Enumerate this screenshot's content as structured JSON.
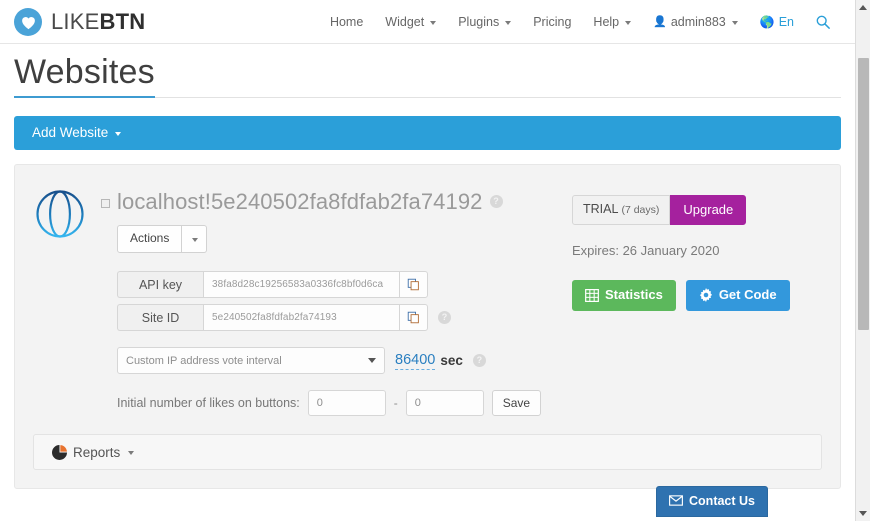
{
  "brand": {
    "part1": "LIKE",
    "part2": "BTN",
    "icon": "heart-icon"
  },
  "nav": {
    "items": [
      {
        "label": "Home",
        "caret": false
      },
      {
        "label": "Widget",
        "caret": true
      },
      {
        "label": "Plugins",
        "caret": true
      },
      {
        "label": "Pricing",
        "caret": false
      },
      {
        "label": "Help",
        "caret": true
      }
    ],
    "user": {
      "label": "admin883",
      "icon": "user-icon"
    },
    "language": {
      "label": "En",
      "icon": "globe-icon"
    },
    "search": {
      "icon": "search-icon"
    }
  },
  "page": {
    "title": "Websites",
    "add_website_label": "Add Website"
  },
  "site": {
    "icon": "globe-icon",
    "name": "localhost!5e240502fa8fdfab2fa74192",
    "help": "?",
    "actions_label": "Actions",
    "credentials": [
      {
        "label": "API key",
        "value": "38fa8d28c19256583a0336fc8bf0d6ca",
        "copy_icon": "copy-icon",
        "help": false
      },
      {
        "label": "Site ID",
        "value": "5e240502fa8fdfab2fa74193",
        "copy_icon": "copy-icon",
        "help": true
      }
    ],
    "interval": {
      "select_value": "Custom IP address vote interval",
      "value": "86400",
      "unit": "sec",
      "help": "?"
    },
    "likes": {
      "label": "Initial number of likes on buttons:",
      "from": "0",
      "to": "0",
      "separator": "-",
      "save_label": "Save"
    },
    "plan": {
      "trial_label": "TRIAL",
      "trial_days": "(7 days)",
      "upgrade_label": "Upgrade",
      "expires": "Expires: 26 January 2020"
    },
    "buttons": {
      "statistics_label": "Statistics",
      "statistics_icon": "table-icon",
      "get_code_label": "Get Code",
      "get_code_icon": "gear-icon"
    }
  },
  "reports": {
    "label": "Reports",
    "icon": "pie-chart-icon"
  },
  "contact": {
    "label": "Contact Us",
    "icon": "envelope-icon"
  },
  "colors": {
    "accent_blue": "#2b9fd9",
    "purple": "#a5219e",
    "green": "#5cb85c",
    "button_blue": "#3398dc",
    "contact_blue": "#2f72b0"
  }
}
